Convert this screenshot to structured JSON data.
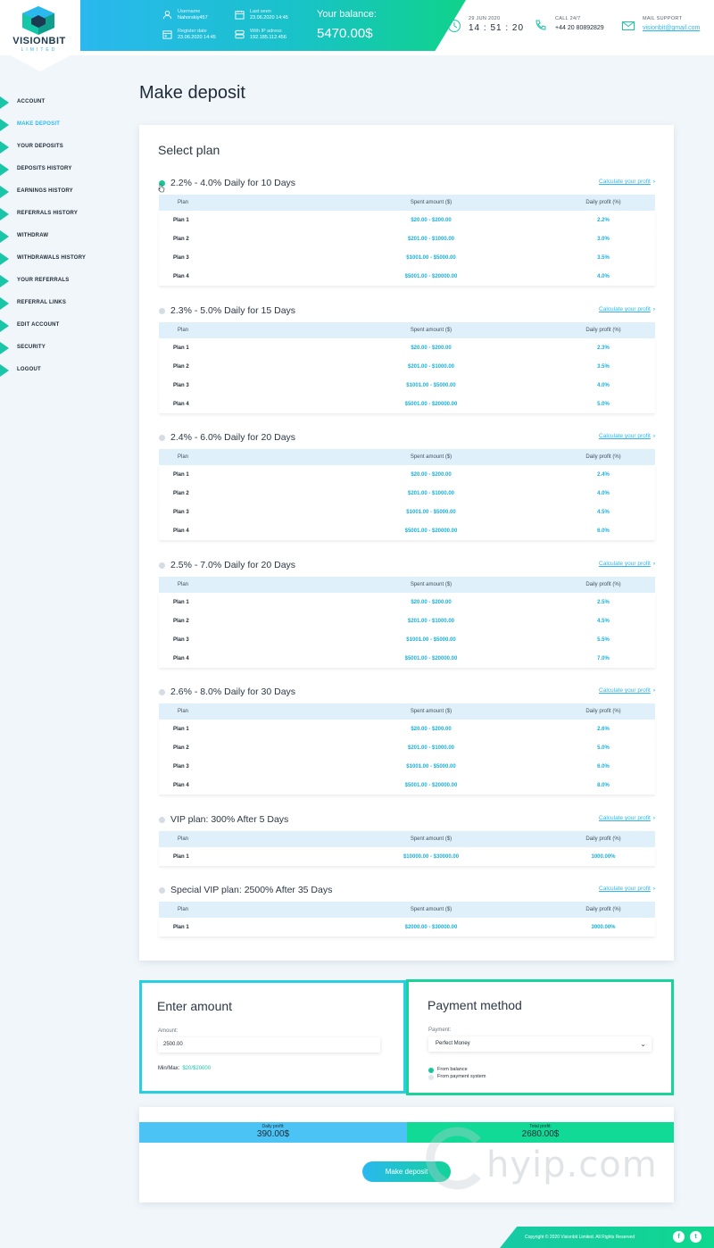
{
  "brand": {
    "name": "VISIONBIT",
    "sub": "LIMITED"
  },
  "header": {
    "username_label": "Username",
    "username": "Nahorskiy457",
    "last_seen_label": "Last seen",
    "last_seen": "23.06.2020 14:45",
    "register_label": "Register date",
    "register_date": "23.06.2020 14:45",
    "ip_label": "With IP adress",
    "ip": "192.185.112.456",
    "balance_label": "Your balance:",
    "balance": "5470.00$",
    "date": "29 JUN 2020",
    "time": "14 : 51 : 20",
    "call_label": "CALL 24/7",
    "phone": "+44 20 80892829",
    "mail_label": "MAIL SUPPORT",
    "email": "visionbit@gmail.com"
  },
  "sidebar": {
    "items": [
      {
        "label": "ACCOUNT"
      },
      {
        "label": "MAKE DEPOSIT"
      },
      {
        "label": "YOUR DEPOSITS"
      },
      {
        "label": "DEPOSITS HISTORY"
      },
      {
        "label": "EARNINGS HISTORY"
      },
      {
        "label": "REFERRALS HISTORY"
      },
      {
        "label": "WITHDRAW"
      },
      {
        "label": "WITHDRAWALS HISTORY"
      },
      {
        "label": "YOUR REFERRALS"
      },
      {
        "label": "REFERRAL LINKS"
      },
      {
        "label": "EDIT ACCOUNT"
      },
      {
        "label": "SECURITY"
      },
      {
        "label": "LOGOUT"
      }
    ]
  },
  "page_title": "Make deposit",
  "select_plan_title": "Select plan",
  "calc_label": "Calculate your profit",
  "table_headers": {
    "plan": "Plan",
    "spent": "Spent amount ($)",
    "profit": "Daily profit (%)"
  },
  "plans": [
    {
      "title": "2.2% - 4.0% Daily for 10 Days",
      "selected": true,
      "rows": [
        {
          "name": "Plan 1",
          "spent": "$20.00 - $200.00",
          "profit": "2.2%"
        },
        {
          "name": "Plan 2",
          "spent": "$201.00 - $1000.00",
          "profit": "3.0%"
        },
        {
          "name": "Plan 3",
          "spent": "$1001.00 - $5000.00",
          "profit": "3.5%"
        },
        {
          "name": "Plan 4",
          "spent": "$5001.00 - $20000.00",
          "profit": "4.0%"
        }
      ]
    },
    {
      "title": "2.3% - 5.0% Daily for 15 Days",
      "selected": false,
      "rows": [
        {
          "name": "Plan 1",
          "spent": "$20.00 - $200.00",
          "profit": "2.3%"
        },
        {
          "name": "Plan 2",
          "spent": "$201.00 - $1000.00",
          "profit": "3.5%"
        },
        {
          "name": "Plan 3",
          "spent": "$1001.00 - $5000.00",
          "profit": "4.0%"
        },
        {
          "name": "Plan 4",
          "spent": "$5001.00 - $20000.00",
          "profit": "5.0%"
        }
      ]
    },
    {
      "title": "2.4% - 6.0% Daily for 20 Days",
      "selected": false,
      "rows": [
        {
          "name": "Plan 1",
          "spent": "$20.00 - $200.00",
          "profit": "2.4%"
        },
        {
          "name": "Plan 2",
          "spent": "$201.00 - $1000.00",
          "profit": "4.0%"
        },
        {
          "name": "Plan 3",
          "spent": "$1001.00 - $5000.00",
          "profit": "4.5%"
        },
        {
          "name": "Plan 4",
          "spent": "$5001.00 - $20000.00",
          "profit": "6.0%"
        }
      ]
    },
    {
      "title": "2.5% - 7.0% Daily for 20 Days",
      "selected": false,
      "rows": [
        {
          "name": "Plan 1",
          "spent": "$20.00 - $200.00",
          "profit": "2.5%"
        },
        {
          "name": "Plan 2",
          "spent": "$201.00 - $1000.00",
          "profit": "4.5%"
        },
        {
          "name": "Plan 3",
          "spent": "$1001.00 - $5000.00",
          "profit": "5.5%"
        },
        {
          "name": "Plan 4",
          "spent": "$5001.00 - $20000.00",
          "profit": "7.0%"
        }
      ]
    },
    {
      "title": "2.6% - 8.0% Daily for 30 Days",
      "selected": false,
      "rows": [
        {
          "name": "Plan 1",
          "spent": "$20.00 - $200.00",
          "profit": "2.6%"
        },
        {
          "name": "Plan 2",
          "spent": "$201.00 - $1000.00",
          "profit": "5.0%"
        },
        {
          "name": "Plan 3",
          "spent": "$1001.00 - $5000.00",
          "profit": "6.0%"
        },
        {
          "name": "Plan 4",
          "spent": "$5001.00 - $20000.00",
          "profit": "8.0%"
        }
      ]
    },
    {
      "title": "VIP plan: 300% After 5 Days",
      "selected": false,
      "rows": [
        {
          "name": "Plan 1",
          "spent": "$10000.00 - $30000.00",
          "profit": "1000.00%"
        }
      ]
    },
    {
      "title": "Special VIP plan: 2500% After 35 Days",
      "selected": false,
      "rows": [
        {
          "name": "Plan 1",
          "spent": "$2000.00 - $30000.00",
          "profit": "3000.00%"
        }
      ]
    }
  ],
  "amount": {
    "title": "Enter amount",
    "label": "Amount:",
    "value": "2500.00",
    "minmax_label": "Min/Max:",
    "minmax_value": "$20/$20000"
  },
  "payment": {
    "title": "Payment method",
    "label": "Payment:",
    "selected": "Perfect Money",
    "options": [
      {
        "label": "From balance",
        "checked": true
      },
      {
        "label": "From payment system",
        "checked": false
      }
    ]
  },
  "profit": {
    "daily_label": "Daily profit:",
    "daily_value": "390.00$",
    "total_label": "Total profit:",
    "total_value": "2680.00$"
  },
  "deposit_button": "Make deposit",
  "footer": {
    "copyright": "Copyright © 2020 Visionbit Limited. All Rights Reserved",
    "social": [
      "f",
      "t"
    ]
  },
  "watermark": "hyip.com",
  "colors": {
    "accent_blue": "#2ab8ef",
    "accent_green": "#12d39a",
    "daily_bar": "#4cc3f5",
    "total_bar": "#11d996"
  }
}
